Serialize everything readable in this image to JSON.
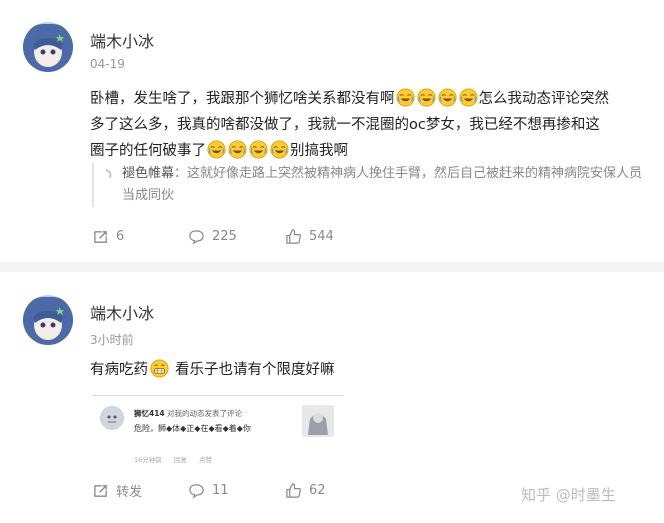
{
  "posts": [
    {
      "username": "端木小冰",
      "time": "04-19",
      "text_a": "卧槽，发生啥了，我跟那个狮忆啥关系都没有啊",
      "text_b": "怎么我动态评论突然",
      "text_c": "多了这么多，我真的啥都没做了，我就一不混圈的oc梦女，我已经不想再掺和这",
      "text_d": "圈子的任何破事了",
      "text_e": "别搞我啊",
      "quote": {
        "name": "褪色帷幕",
        "colon": "：",
        "text": "这就好像走路上突然被精神病人挽住手臂，然后自己被赶来的精神病院安保人员当成同伙"
      },
      "actions": {
        "repost": "6",
        "comments": "225",
        "likes": "544"
      }
    },
    {
      "username": "端木小冰",
      "time": "3小时前",
      "text_a": "有病吃药",
      "text_b": "看乐子也请有个限度好嘛",
      "embed": {
        "user": "狮忆414",
        "action": "对我的动态发表了评论",
        "content": "危险，狮◆体◆正◆在◆看◆着◆你",
        "time": "16分钟前",
        "reply": "回复",
        "like": "点赞"
      },
      "actions": {
        "repost": "转发",
        "comments": "11",
        "likes": "62"
      }
    }
  ],
  "watermark": "知乎 @时墨生",
  "icons": {
    "repost": "repost-icon",
    "comment": "comment-icon",
    "like": "thumbs-up-icon",
    "emoji_laugh": "laugh-cry-emoji",
    "emoji_grin": "grin-emoji"
  },
  "colors": {
    "accent_gray": "#8a8a8a",
    "divider": "#f4f4f4"
  }
}
